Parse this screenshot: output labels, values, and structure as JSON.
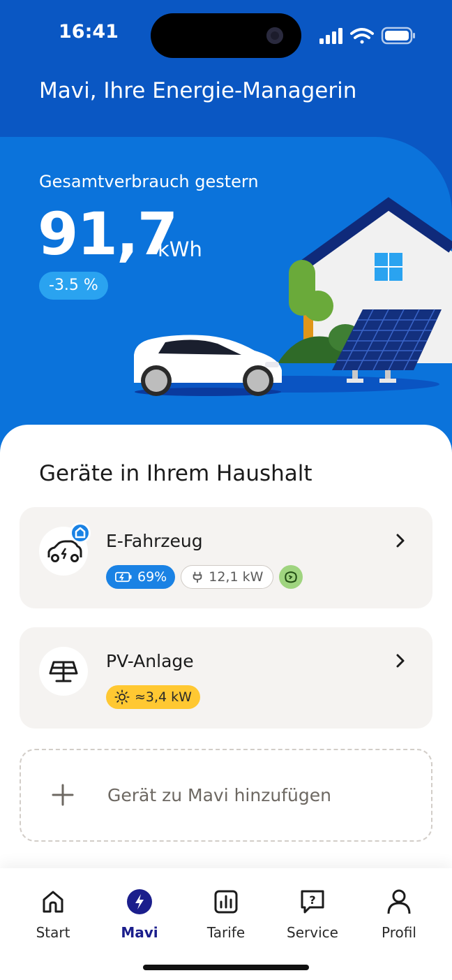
{
  "status_bar": {
    "time": "16:41"
  },
  "header": {
    "title": "Mavi, Ihre Energie-Managerin"
  },
  "usage": {
    "label": "Gesamtverbrauch gestern",
    "value": "91,7",
    "unit": "kWh",
    "change": "-3.5 %"
  },
  "devices": {
    "title": "Geräte in Ihrem Haushalt",
    "items": [
      {
        "name": "E-Fahrzeug",
        "icon": "electric-car-icon",
        "battery": "69%",
        "power": "12,1 kW"
      },
      {
        "name": "PV-Anlage",
        "icon": "solar-panel-icon",
        "production": "≈3,4 kW"
      }
    ],
    "add_label": "Gerät zu Mavi hinzufügen"
  },
  "tabs": [
    {
      "label": "Start",
      "icon": "home-icon"
    },
    {
      "label": "Mavi",
      "icon": "bolt-icon",
      "active": true
    },
    {
      "label": "Tarife",
      "icon": "chart-icon"
    },
    {
      "label": "Service",
      "icon": "help-chat-icon"
    },
    {
      "label": "Profil",
      "icon": "user-icon"
    }
  ],
  "colors": {
    "header_dark": "#0a57c3",
    "header": "#0b73db",
    "accent": "#1a82e4",
    "active_tab": "#1b1e8c",
    "sun": "#ffc832",
    "eco": "#9fd47f"
  }
}
